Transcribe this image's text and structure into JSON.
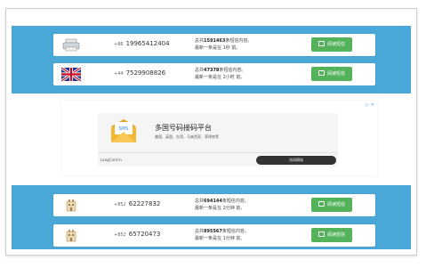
{
  "rows_top": [
    {
      "flag_icon": "printer-icon",
      "country_code": "+86",
      "number": "19965412404",
      "info_prefix": "总共",
      "count": "1591463",
      "info_suffix": "条短信内容。",
      "latest": "最新一条是在 1秒 前。",
      "button_label": "阅读短信"
    },
    {
      "flag_icon": "uk-flag-icon",
      "country_code": "+44",
      "number": "7529908826",
      "info_prefix": "总共",
      "count": "47378",
      "info_suffix": "条短信内容。",
      "latest": "最新一条是在 2小时 前。",
      "button_label": "阅读短信"
    }
  ],
  "rows_bottom": [
    {
      "flag_icon": "hk-flag-icon",
      "country_code": "+852",
      "number": "62227832",
      "info_prefix": "总共",
      "count": "694144",
      "info_suffix": "条短信内容。",
      "latest": "最新一条是在 2分钟 前。",
      "button_label": "阅读短信"
    },
    {
      "flag_icon": "hk-flag-icon",
      "country_code": "+852",
      "number": "65720473",
      "info_prefix": "总共",
      "count": "895567",
      "info_suffix": "条短信内容。",
      "latest": "最新一条是在 1分钟 前。",
      "button_label": "阅读短信"
    }
  ],
  "ad": {
    "choices_mark": "▷ ✕",
    "envelope_text": "SMS",
    "title": "多国号码接码平台",
    "subtitle": "美国、英国、台湾、马来西亚、菲律宾等",
    "site": "LongCard.in",
    "button": "访问网站"
  },
  "colors": {
    "band_blue": "#4aa8d8",
    "button_green": "#53b25a"
  }
}
